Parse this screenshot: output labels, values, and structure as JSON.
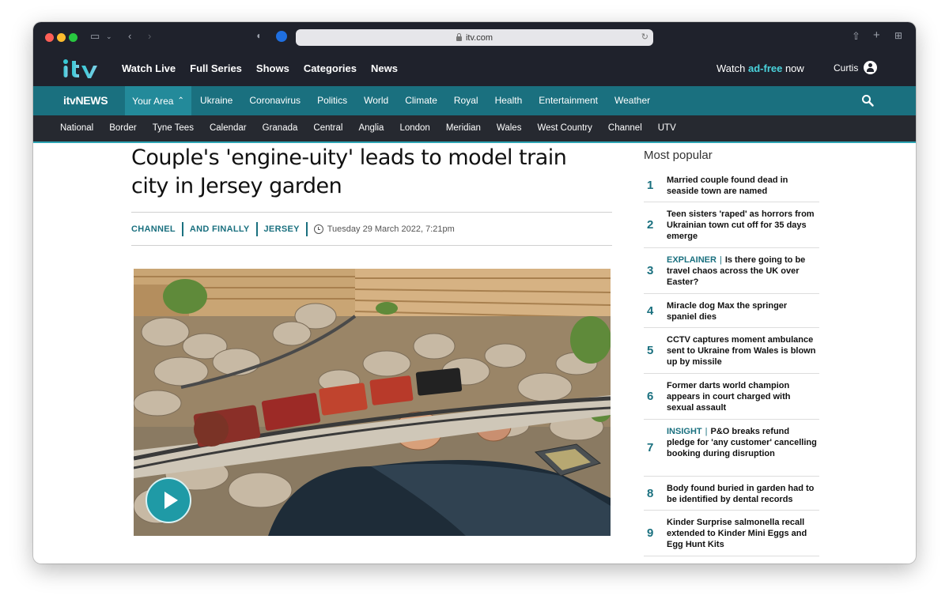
{
  "browser": {
    "url": "itv.com"
  },
  "top_nav": {
    "items": [
      "Watch Live",
      "Full Series",
      "Shows",
      "Categories",
      "News"
    ],
    "adfree_prefix": "Watch ",
    "adfree_highlight": "ad-free",
    "adfree_suffix": " now",
    "user_name": "Curtis"
  },
  "news_nav": {
    "logo_text": "itvNEWS",
    "your_area": "Your Area",
    "items": [
      "Ukraine",
      "Coronavirus",
      "Politics",
      "World",
      "Climate",
      "Royal",
      "Health",
      "Entertainment",
      "Weather"
    ]
  },
  "region_nav": {
    "items": [
      "National",
      "Border",
      "Tyne Tees",
      "Calendar",
      "Granada",
      "Central",
      "Anglia",
      "London",
      "Meridian",
      "Wales",
      "West Country",
      "Channel",
      "UTV"
    ]
  },
  "article": {
    "headline": "Couple's 'engine-uity' leads to model train city in Jersey garden",
    "tags": [
      "CHANNEL",
      "AND FINALLY",
      "JERSEY"
    ],
    "timestamp": "Tuesday 29 March 2022, 7:21pm"
  },
  "most_popular": {
    "title": "Most popular",
    "items": [
      {
        "num": "1",
        "label": "",
        "text": "Married couple found dead in seaside town are named"
      },
      {
        "num": "2",
        "label": "",
        "text": "Teen sisters 'raped' as horrors from Ukrainian town cut off for 35 days emerge"
      },
      {
        "num": "3",
        "label": "EXPLAINER",
        "text": "Is there going to be travel chaos across the UK over Easter?"
      },
      {
        "num": "4",
        "label": "",
        "text": "Miracle dog Max the springer spaniel dies"
      },
      {
        "num": "5",
        "label": "",
        "text": "CCTV captures moment ambulance sent to Ukraine from Wales is blown up by missile"
      },
      {
        "num": "6",
        "label": "",
        "text": "Former darts world champion appears in court charged with sexual assault"
      },
      {
        "num": "7",
        "label": "INSIGHT",
        "text": "P&O breaks refund pledge for 'any customer' cancelling booking during disruption"
      },
      {
        "num": "8",
        "label": "",
        "text": "Body found buried in garden had to be identified by dental records"
      },
      {
        "num": "9",
        "label": "",
        "text": "Kinder Surprise salmonella recall extended to Kinder Mini Eggs and Egg Hunt Kits"
      }
    ]
  },
  "colors": {
    "brand_teal": "#1a707f",
    "accent_cyan": "#4ad3dc",
    "dark_bar": "#1f222c"
  }
}
